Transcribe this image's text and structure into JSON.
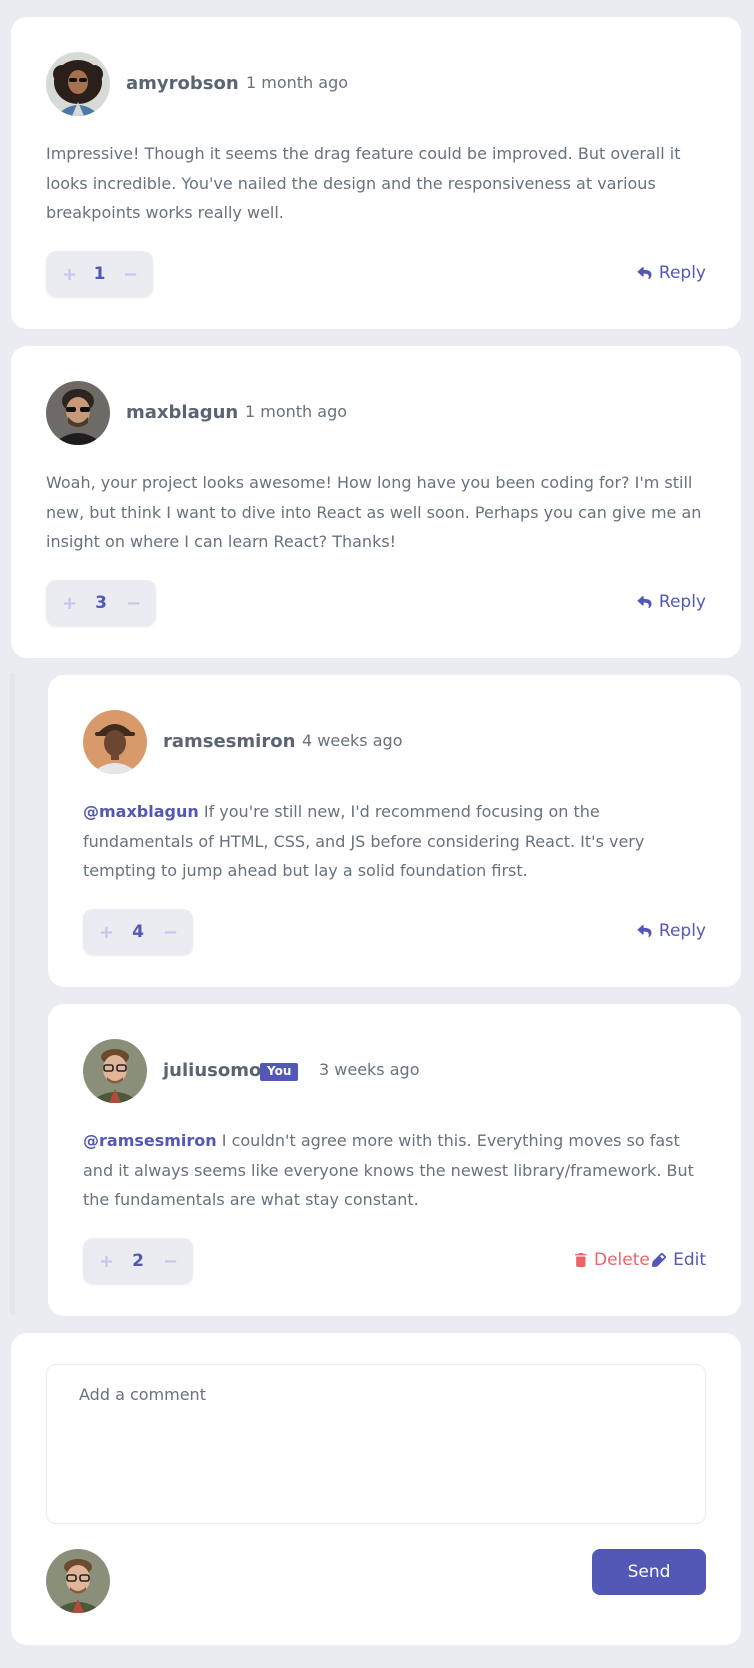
{
  "comments": [
    {
      "username": "amyrobson",
      "created_at": "1 month ago",
      "content": "Impressive! Though it seems the drag feature could be improved. But overall it looks incredible. You've nailed the design and the responsiveness at various breakpoints works really well.",
      "score": "1",
      "reply_label": "Reply",
      "avatar_icon": "avatar-amyrobson"
    },
    {
      "username": "maxblagun",
      "created_at": "1 month ago",
      "content": "Woah, your project looks awesome! How long have you been coding for? I'm still new, but think I want to dive into React as well soon. Perhaps you can give me an insight on where I can learn React? Thanks!",
      "score": "3",
      "reply_label": "Reply",
      "avatar_icon": "avatar-maxblagun"
    }
  ],
  "replies": [
    {
      "username": "ramsesmiron",
      "created_at": "4 weeks ago",
      "replying_to": "@maxblagun",
      "content": "If you're still new, I'd recommend focusing on the fundamentals of HTML, CSS, and JS before considering React. It's very tempting to jump ahead but lay a solid foundation first.",
      "score": "4",
      "reply_label": "Reply",
      "avatar_icon": "avatar-ramsesmiron"
    },
    {
      "username": "juliusomo",
      "you_badge": "You",
      "created_at": "3 weeks ago",
      "replying_to": "@ramsesmiron",
      "content": "I couldn't agree more with this. Everything moves so fast and it always seems like everyone knows the newest library/framework. But the fundamentals are what stay constant.",
      "score": "2",
      "delete_label": "Delete",
      "edit_label": "Edit",
      "avatar_icon": "avatar-juliusomo"
    }
  ],
  "vote": {
    "plus": "+",
    "minus": "−"
  },
  "new_comment": {
    "placeholder": "Add a comment",
    "send_label": "Send"
  },
  "colors": {
    "moderate_blue": "#5357b6",
    "soft_red": "#ed6468",
    "light_grayish_blue": "#c5c6ef",
    "grayish_blue": "#67727e",
    "background": "#eaecf1"
  }
}
